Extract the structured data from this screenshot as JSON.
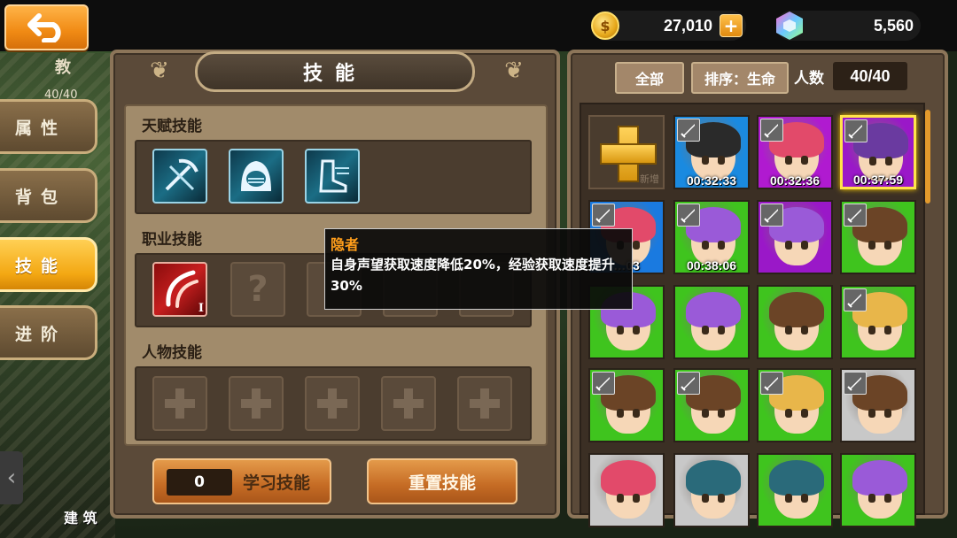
{
  "topbar": {
    "back_label": "back",
    "coins": "27,010",
    "gems": "5,560"
  },
  "background": {
    "left_tab_label": "教",
    "left_count": "40/40",
    "bottom_label": "建 筑"
  },
  "sidebar": {
    "items": [
      {
        "label": "属性",
        "active": false
      },
      {
        "label": "背包",
        "active": false
      },
      {
        "label": "技能",
        "active": true
      },
      {
        "label": "进阶",
        "active": false
      }
    ]
  },
  "skill_panel": {
    "title": "技能",
    "sections": [
      {
        "label": "天赋技能"
      },
      {
        "label": "职业技能"
      },
      {
        "label": "人物技能"
      }
    ],
    "learn_count": "0",
    "learn_label": "学习技能",
    "reset_label": "重置技能",
    "class_skill_level": "I",
    "empty_slot_mark": "?"
  },
  "tooltip": {
    "title": "隐者",
    "description": "自身声望获取速度降低20%，经验获取速度提升30%"
  },
  "hero_panel": {
    "filter_all": "全部",
    "sort_label": "排序：生命",
    "count_label": "人数",
    "count_value": "40/40",
    "new_label": "新增",
    "heroes": [
      {
        "bg": "#1a8ae0",
        "hair": "#2a2a2a",
        "timer": "00:32:33",
        "sword": true
      },
      {
        "bg": "#b01ad0",
        "hair": "#e24a6a",
        "timer": "00:32:36",
        "sword": true
      },
      {
        "bg": "#9a18c8",
        "hair": "#6a3aa0",
        "timer": "00:37:59",
        "sword": true,
        "selected": true
      },
      {
        "bg": "#1a7ae0",
        "hair": "#e24a6a",
        "timer": "…03",
        "sword": true
      },
      {
        "bg": "#3fc41e",
        "hair": "#9a5ad8",
        "timer": "00:38:06",
        "sword": true
      },
      {
        "bg": "#9a18c8",
        "hair": "#9a5ad8",
        "timer": "",
        "sword": true
      },
      {
        "bg": "#3fc41e",
        "hair": "#6b4426",
        "timer": "",
        "sword": true
      },
      {
        "bg": "#3fc41e",
        "hair": "#9a5ad8",
        "timer": "",
        "sword": false
      },
      {
        "bg": "#3fc41e",
        "hair": "#9a5ad8",
        "timer": "",
        "sword": false
      },
      {
        "bg": "#3fc41e",
        "hair": "#6b4426",
        "timer": "",
        "sword": false
      },
      {
        "bg": "#3fc41e",
        "hair": "#e8b64a",
        "timer": "",
        "sword": true
      },
      {
        "bg": "#3fc41e",
        "hair": "#6b4426",
        "timer": "",
        "sword": true
      },
      {
        "bg": "#3fc41e",
        "hair": "#6b4426",
        "timer": "",
        "sword": true
      },
      {
        "bg": "#3fc41e",
        "hair": "#e8b64a",
        "timer": "",
        "sword": true
      },
      {
        "bg": "#c8c8c8",
        "hair": "#6b4426",
        "timer": "",
        "sword": true
      },
      {
        "bg": "#c8c8c8",
        "hair": "#e24a6a",
        "timer": "",
        "sword": false
      },
      {
        "bg": "#c8c8c8",
        "hair": "#2a6a7a",
        "timer": "",
        "sword": false
      },
      {
        "bg": "#3fc41e",
        "hair": "#2a6a7a",
        "timer": "",
        "sword": false
      },
      {
        "bg": "#3fc41e",
        "hair": "#9a5ad8",
        "timer": "",
        "sword": false
      }
    ]
  }
}
